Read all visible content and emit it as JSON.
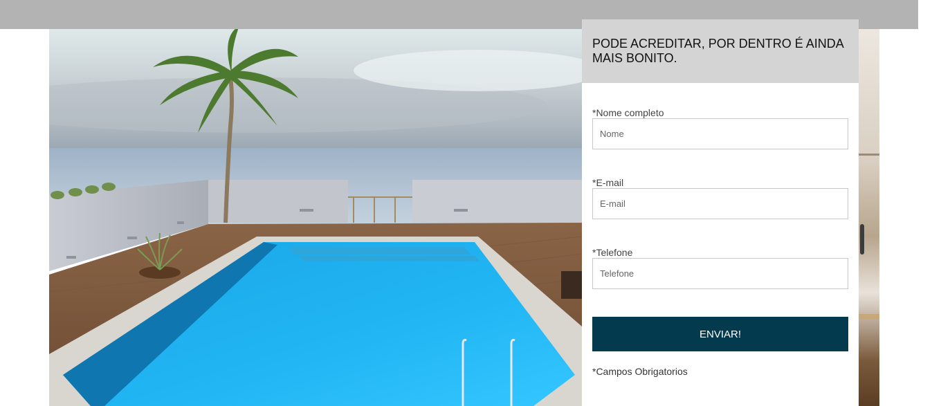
{
  "hero": {
    "image_description": "rooftop-pool-with-palm-tree"
  },
  "form": {
    "title": "PODE ACREDITAR, POR DENTRO É AINDA MAIS BONITO.",
    "fields": [
      {
        "label": "*Nome completo",
        "placeholder": "Nome"
      },
      {
        "label": "*E-mail",
        "placeholder": "E-mail"
      },
      {
        "label": "*Telefone",
        "placeholder": "Telefone"
      }
    ],
    "submit_label": "ENVIAR!",
    "required_note": "*Campos Obrigatorios"
  },
  "colors": {
    "top_bar": "#b3b3b3",
    "panel_header": "#d4d4d4",
    "submit_button": "#033a4d"
  }
}
